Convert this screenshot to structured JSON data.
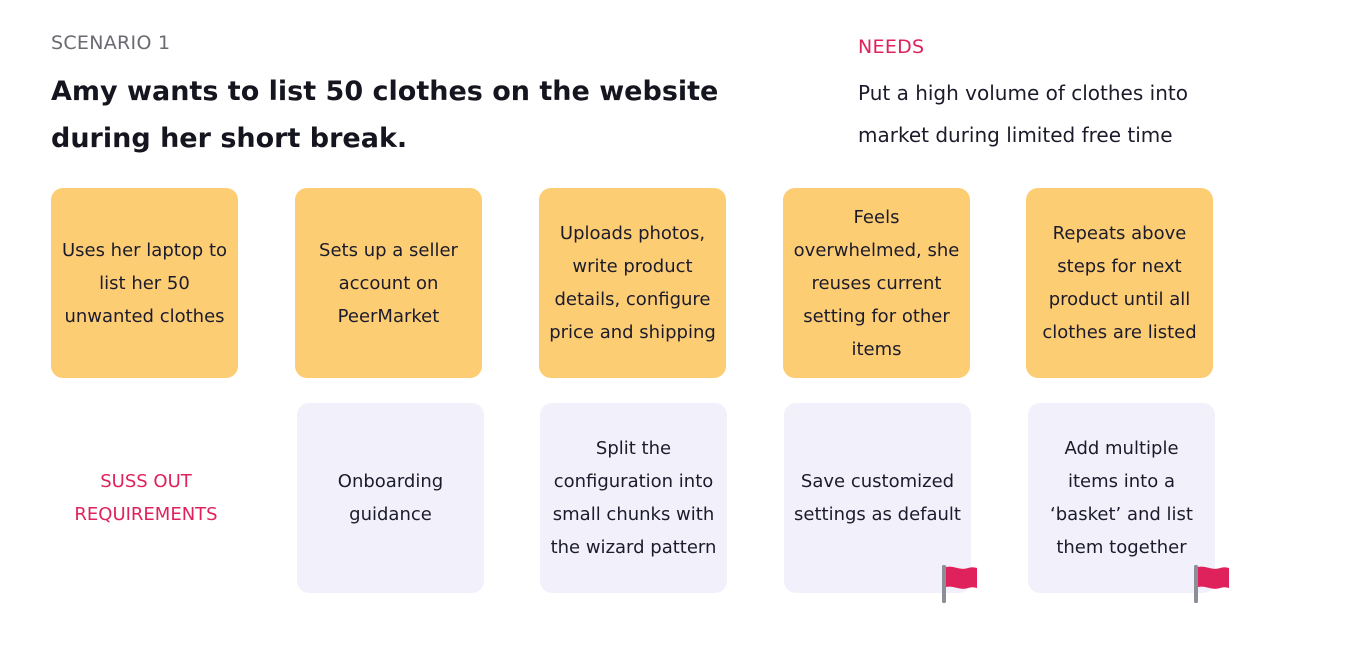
{
  "scenario": {
    "label": "SCENARIO 1",
    "title": "Amy wants to list 50 clothes on the website during her short break."
  },
  "needs": {
    "label": "NEEDS",
    "text": "Put a high volume of clothes into market during limited free time"
  },
  "steps": [
    "Uses her laptop to list her 50 unwanted clothes",
    "Sets up a seller account on PeerMarket",
    "Uploads photos, write product details, configure price and shipping",
    "Feels overwhelmed, she reuses current setting for other items",
    "Repeats above steps for next product until all clothes are listed"
  ],
  "requirements": {
    "label": "SUSS OUT REQUIREMENTS",
    "items": [
      "Onboarding guidance",
      "Split the configuration into small chunks with the wizard pattern",
      "Save customized settings as default",
      "Add multiple items into a ‘basket’ and list them together"
    ]
  },
  "icons": {
    "flag": "red-flag-icon"
  },
  "colors": {
    "step_card": "#fdcd74",
    "requirement_card": "#f2f0fb",
    "accent": "#e0225c"
  }
}
